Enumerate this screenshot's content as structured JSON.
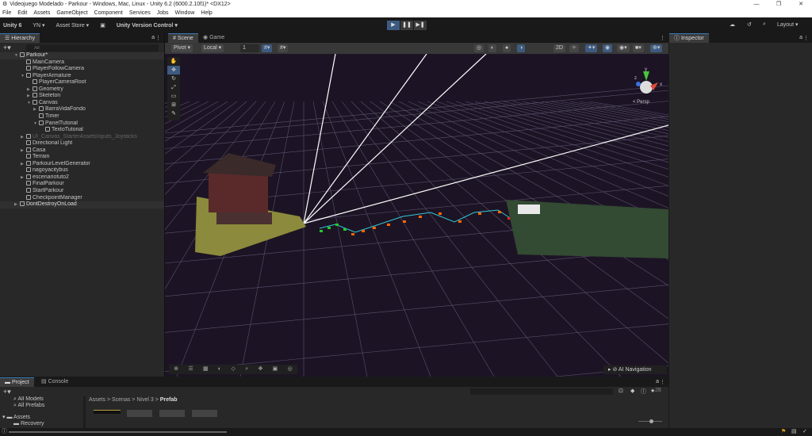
{
  "window": {
    "title": "Videojuego Modelado - Parkour - Windows, Mac, Linux - Unity 6.2 (6000.2.10f1)* <DX12>",
    "minimize": "—",
    "maximize": "❐",
    "close": "✕"
  },
  "menu": [
    "File",
    "Edit",
    "Assets",
    "GameObject",
    "Component",
    "Services",
    "Jobs",
    "Window",
    "Help"
  ],
  "toolbar": {
    "unity": "Unity 6",
    "account": "YN ▾",
    "asset_store": "Asset Store ▾",
    "version_control": "Unity Version Control ▾",
    "layout": "Layout ▾",
    "play": "▶",
    "pause": "❚❚",
    "step": "▶❚"
  },
  "hierarchy": {
    "tab": "Hierarchy",
    "search_placeholder": "All",
    "items": [
      {
        "label": "Parkour*",
        "depth": 0,
        "arrow": "▼",
        "scene": true
      },
      {
        "label": "MainCamera",
        "depth": 1,
        "arrow": ""
      },
      {
        "label": "PlayerFollowCamera",
        "depth": 1,
        "arrow": ""
      },
      {
        "label": "PlayerArmature",
        "depth": 1,
        "arrow": "▼"
      },
      {
        "label": "PlayerCameraRoot",
        "depth": 2,
        "arrow": ""
      },
      {
        "label": "Geometry",
        "depth": 2,
        "arrow": "▶"
      },
      {
        "label": "Skeleton",
        "depth": 2,
        "arrow": "▶"
      },
      {
        "label": "Canvas",
        "depth": 2,
        "arrow": "▼"
      },
      {
        "label": "BarraVidaFondo",
        "depth": 3,
        "arrow": "▶"
      },
      {
        "label": "Timer",
        "depth": 3,
        "arrow": ""
      },
      {
        "label": "PanelTutorial",
        "depth": 3,
        "arrow": "▼"
      },
      {
        "label": "TextoTutorial",
        "depth": 4,
        "arrow": ""
      },
      {
        "label": "UI_Canvas_StarterAssetsInputs_Joysticks",
        "depth": 1,
        "arrow": "▶",
        "dim": true
      },
      {
        "label": "Directional Light",
        "depth": 1,
        "arrow": ""
      },
      {
        "label": "Casa",
        "depth": 1,
        "arrow": "▶"
      },
      {
        "label": "Terrain",
        "depth": 1,
        "arrow": ""
      },
      {
        "label": "ParkourLevelGenerator",
        "depth": 1,
        "arrow": "▶"
      },
      {
        "label": "nagoyacitybus",
        "depth": 1,
        "arrow": ""
      },
      {
        "label": "escenariotuto2",
        "depth": 1,
        "arrow": "▶"
      },
      {
        "label": "FinalParkour",
        "depth": 1,
        "arrow": ""
      },
      {
        "label": "StartParkour",
        "depth": 1,
        "arrow": ""
      },
      {
        "label": "CheckpointManager",
        "depth": 1,
        "arrow": ""
      },
      {
        "label": "DontDestroyOnLoad",
        "depth": 0,
        "arrow": "▶",
        "scene": true
      }
    ]
  },
  "scene": {
    "tab_scene": "Scene",
    "tab_game": "Game",
    "pivot": "Pivot ▾",
    "local": "Local ▾",
    "snap_value": "1",
    "persp": "< Persp",
    "ai_navigation": "AI Navigation",
    "axis_x": "x",
    "axis_y": "y",
    "axis_z": "z"
  },
  "inspector": {
    "tab": "Inspector"
  },
  "project": {
    "tab_project": "Project",
    "tab_console": "Console",
    "favorites": [
      "All Models",
      "All Prefabs"
    ],
    "assets_root": "Assets",
    "assets_child": "Recovery",
    "breadcrumb": [
      "Assets",
      "Scenas",
      "Nivel 3",
      "Prefab"
    ],
    "hidden_count": "28"
  },
  "colors": {
    "accent": "#3a79bb",
    "scene_bg": "#1c1424"
  }
}
